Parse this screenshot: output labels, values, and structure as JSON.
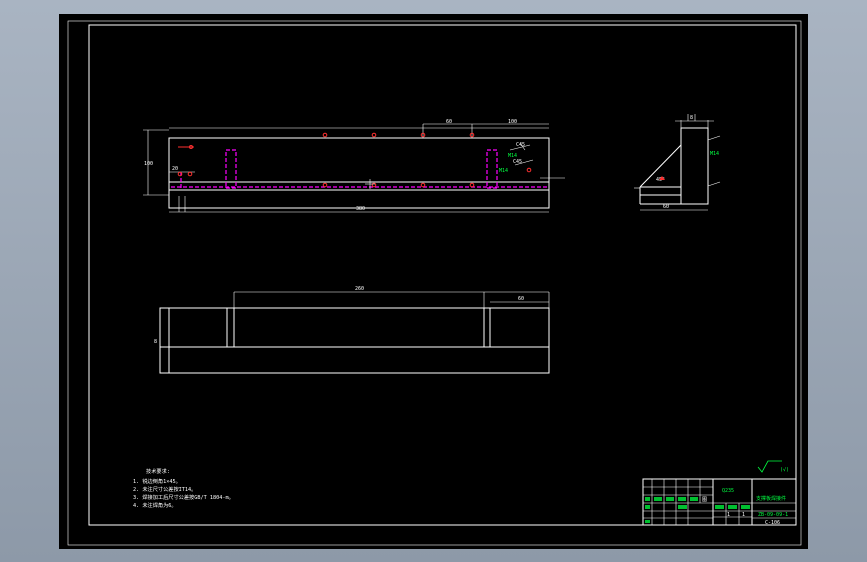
{
  "drawing": {
    "notes_title": "技术要求:",
    "notes": [
      "1. 锐边倒角1×45。",
      "2. 未注尺寸公差按IT14。",
      "3. 焊接加工后尺寸公差按GB/T 1804-m。",
      "4. 未注焊角为6。"
    ],
    "surface_finish_mark": "(√)",
    "title_block": {
      "material": "Q235",
      "part_name": "支撑板焊接件",
      "drawing_no": "ZB-09-09-1",
      "sheet_no": "C-106"
    }
  },
  "colors": {
    "page_background": "#a9b4c2",
    "sheet": "#000000",
    "outline": "#ffffff",
    "hidden_lines": "#ff00ff",
    "weld_marks": "#ff3030",
    "annotations": "#00ff40"
  }
}
